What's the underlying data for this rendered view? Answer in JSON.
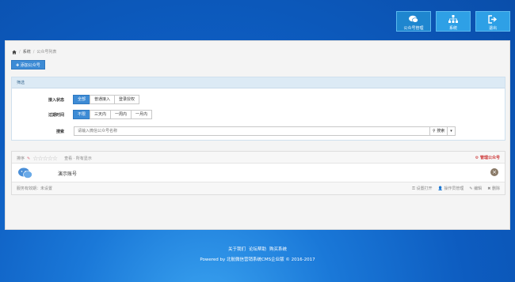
{
  "topnav": [
    {
      "label": "公众号管理",
      "icon": "chat-bubbles-icon",
      "active": true
    },
    {
      "label": "系统",
      "icon": "sitemap-icon",
      "active": false
    },
    {
      "label": "退出",
      "icon": "sign-out-icon",
      "active": false
    }
  ],
  "breadcrumb": {
    "home_icon": "home-icon",
    "item1": "系统",
    "sep": "/",
    "current": "公众号列表"
  },
  "add_button": "添加公众号",
  "filter": {
    "title": "筛选",
    "access_label": "接入状态",
    "access_options": [
      "全部",
      "普通接入",
      "登录授权"
    ],
    "expire_label": "过期时间",
    "expire_options": [
      "不限",
      "三天内",
      "一周内",
      "一月内"
    ],
    "search_label": "搜索",
    "search_placeholder": "请输入微信公众号名称",
    "search_button": "搜索"
  },
  "list": {
    "sort_label": "排序",
    "view_label": "查看 · 所有显示",
    "manage_label": "管理公众号",
    "account_name": "演示账号",
    "footer_left": "服务有效期：未设置",
    "actions": [
      "设置打开",
      "操作员管理",
      "编辑",
      "删除"
    ]
  },
  "footer": {
    "links": [
      "关于我们",
      "论坛帮助",
      "购买系统"
    ],
    "copyright": "Powered by 北航微信营销系统CMS企业版 © 2016-2017"
  },
  "colors": {
    "accent": "#3d8bd5",
    "background": "#0d5cc0"
  }
}
